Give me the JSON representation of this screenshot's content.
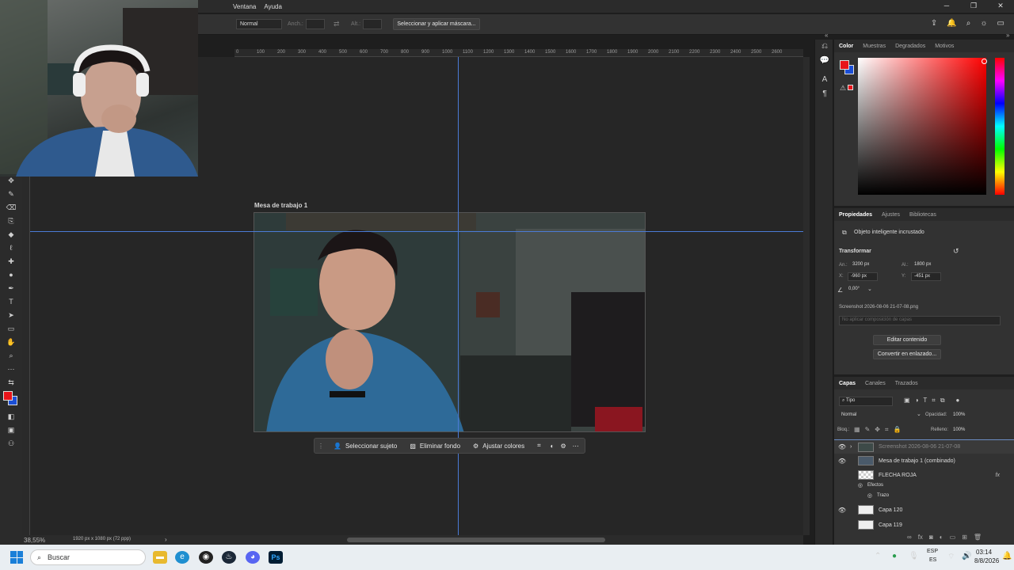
{
  "menu": {
    "items": [
      "Ventana",
      "Ayuda"
    ]
  },
  "options": {
    "blend_mode": "Normal",
    "width_label": "Anch.:",
    "height_label": "Alt.:",
    "mask_button": "Seleccionar y aplicar máscara..."
  },
  "ruler": {
    "ticks": [
      "0",
      "100",
      "200",
      "300",
      "400",
      "500",
      "600",
      "700",
      "800",
      "900",
      "1000",
      "1100",
      "1200",
      "1300",
      "1400",
      "1500",
      "1600",
      "1700",
      "1800",
      "1900",
      "2000",
      "2100",
      "2200",
      "2300",
      "2400",
      "2500",
      "2600"
    ]
  },
  "artboard": {
    "title": "Mesa de trabajo 1"
  },
  "context_bar": {
    "select_subject": "Seleccionar sujeto",
    "remove_bg": "Eliminar fondo",
    "adjust_colors": "Ajustar colores"
  },
  "status": {
    "zoom": "38,55%",
    "info": "1920 px x 1080 px (72 ppp)"
  },
  "color_panel": {
    "tabs": [
      "Color",
      "Muestras",
      "Degradados",
      "Motivos"
    ],
    "fg": "#e8141a",
    "bg": "#1b4fd6"
  },
  "properties": {
    "tabs": [
      "Propiedades",
      "Ajustes",
      "Bibliotecas"
    ],
    "kind": "Objeto inteligente incrustado",
    "section": "Transformar",
    "w_label": "An.:",
    "w": "3200 px",
    "h_label": "Al.:",
    "h": "1800 px",
    "x_label": "X:",
    "x": "-960 px",
    "y_label": "Y:",
    "y": "-451 px",
    "angle": "0,00°",
    "filename": "Screenshot 2026-08-06 21-07-08.png",
    "comp_placeholder": "No aplicar composición de capas",
    "edit_button": "Editar contenido",
    "convert_button": "Convertir en enlazado..."
  },
  "layers": {
    "tabs": [
      "Capas",
      "Canales",
      "Trazados"
    ],
    "filter": "Tipo",
    "blend": "Normal",
    "opacity_label": "Opacidad:",
    "opacity": "100%",
    "lock_label": "Bloq.:",
    "fill_label": "Relleno:",
    "fill": "100%",
    "rows": [
      {
        "name": "Screenshot 2026-08-06 21-07-08",
        "visible": true
      },
      {
        "name": "Mesa de trabajo 1 (combinado)",
        "visible": true
      },
      {
        "name": "FLECHA ROJA",
        "visible": false
      },
      {
        "name": "Efectos",
        "visible": false
      },
      {
        "name": "Trazo",
        "visible": false
      },
      {
        "name": "Capa 120",
        "visible": true
      },
      {
        "name": "Capa 119",
        "visible": false
      }
    ]
  },
  "taskbar": {
    "search": "Buscar",
    "lang1": "ESP",
    "lang2": "ES",
    "time": "03:14",
    "date": "8/8/2026"
  }
}
